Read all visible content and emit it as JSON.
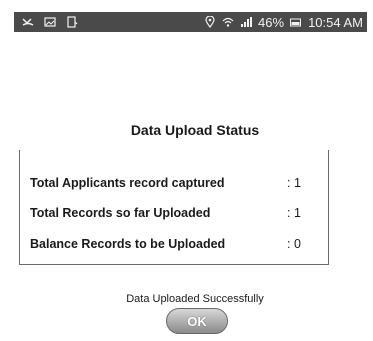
{
  "status_bar": {
    "battery_text": "46%",
    "time": "10:54 AM"
  },
  "dialog": {
    "title": "Data Upload Status",
    "rows": [
      {
        "label": "Total Applicants record captured",
        "value": ": 1"
      },
      {
        "label": "Total Records so far Uploaded",
        "value": ": 1"
      },
      {
        "label": "Balance Records to be Uploaded",
        "value": ": 0"
      }
    ]
  },
  "message": "Data Uploaded Successfully",
  "ok_button": {
    "label": "OK"
  }
}
